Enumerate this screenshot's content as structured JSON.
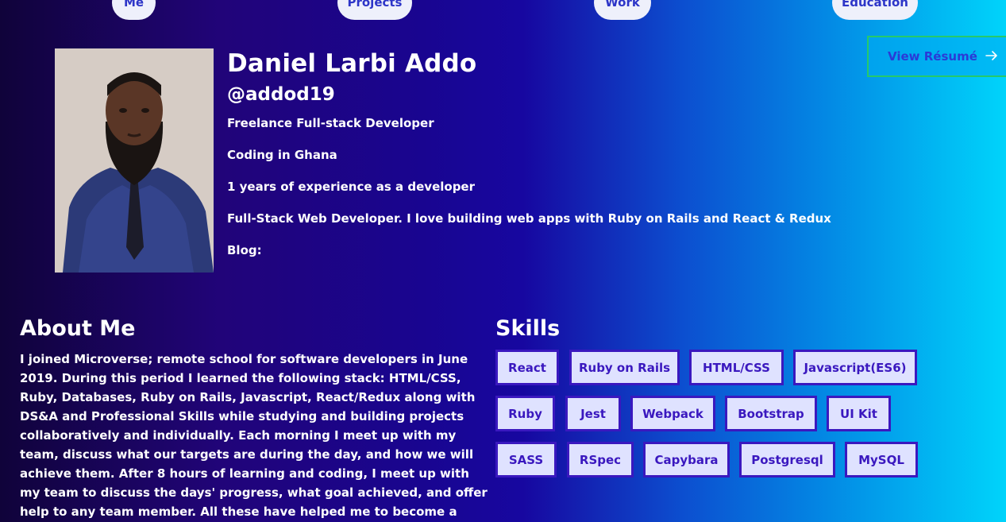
{
  "nav": {
    "items": [
      {
        "label": "Me"
      },
      {
        "label": "Projects"
      },
      {
        "label": "Work"
      },
      {
        "label": "Education"
      }
    ]
  },
  "profile": {
    "name": "Daniel Larbi Addo",
    "handle": "@addod19",
    "lines": [
      "Freelance Full-stack Developer",
      "Coding in Ghana",
      "1 years of experience as a developer",
      "Full-Stack Web Developer. I love building web apps with Ruby on Rails and React & Redux",
      "Blog:"
    ]
  },
  "resume": {
    "label": "View Résumé",
    "icon": "arrow-right-icon"
  },
  "about": {
    "title": "About Me",
    "text": "I joined Microverse; remote school for software developers in June 2019. During this period I learned the following stack: HTML/CSS, Ruby, Databases, Ruby on Rails, Javascript, React/Redux along with DS&A and Professional Skills while studying and building projects collaboratively and individually. Each morning I meet up with my team, discuss what our targets are during the day, and how we will achieve them. After 8 hours of learning and coding, I meet up with my team to discuss the days' progress, what goal achieved, and offer help to any team member. All these have helped me to become a skillful Full-Stack Web Developer"
  },
  "skills": {
    "title": "Skills",
    "items": [
      "React",
      "Ruby on Rails",
      "HTML/CSS",
      "Javascript(ES6)",
      "Ruby",
      "Jest",
      "Webpack",
      "Bootstrap",
      "UI Kit",
      "SASS",
      "RSpec",
      "Capybara",
      "Postgresql",
      "MySQL"
    ]
  },
  "colors": {
    "accent": "#3a18bf",
    "skill_bg": "#dfe2ff",
    "resume_border": "#26c96a",
    "nav_pill_bg": "#eef0fb"
  }
}
